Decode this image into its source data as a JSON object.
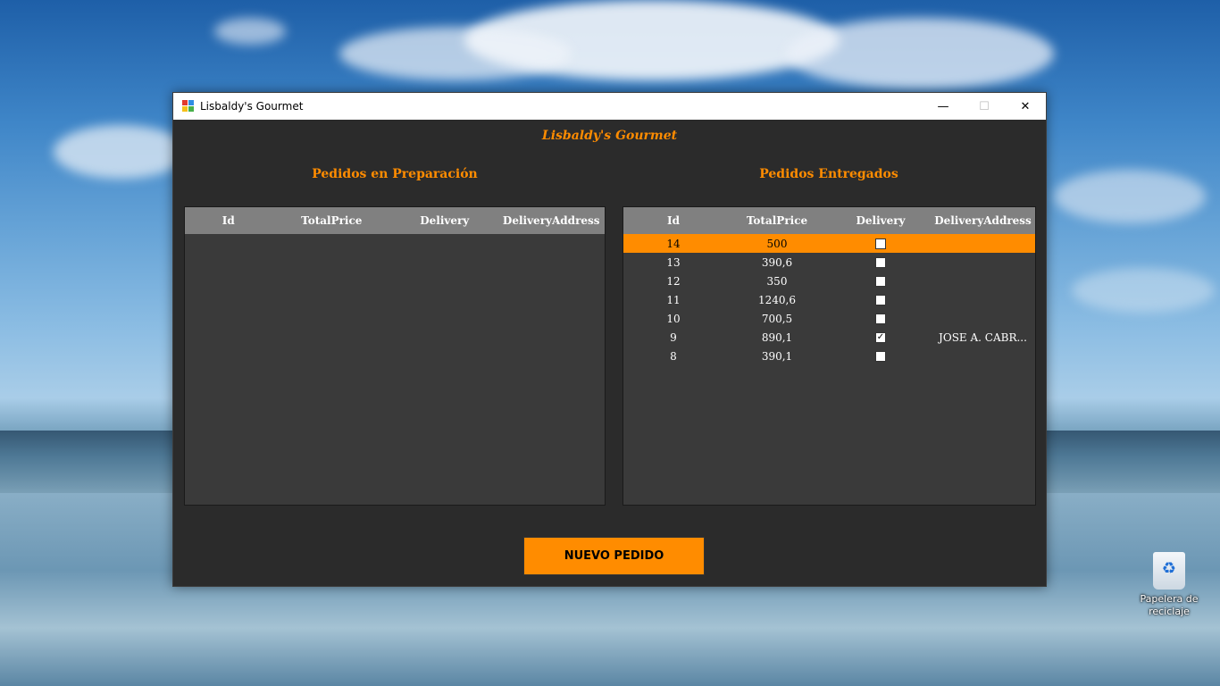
{
  "window": {
    "title": "Lisbaldy's Gourmet",
    "controls": {
      "minimize": "—",
      "maximize": "☐",
      "close": "✕"
    }
  },
  "app": {
    "title": "Lisbaldy's Gourmet",
    "accent_color": "#ff8c00"
  },
  "preparing": {
    "title": "Pedidos en Preparación",
    "columns": [
      "Id",
      "TotalPrice",
      "Delivery",
      "DeliveryAddress"
    ],
    "rows": []
  },
  "delivered": {
    "title": "Pedidos Entregados",
    "columns": [
      "Id",
      "TotalPrice",
      "Delivery",
      "DeliveryAddress"
    ],
    "rows": [
      {
        "id": "14",
        "total": "500",
        "delivery": false,
        "address": "",
        "selected": true
      },
      {
        "id": "13",
        "total": "390,6",
        "delivery": false,
        "address": ""
      },
      {
        "id": "12",
        "total": "350",
        "delivery": false,
        "address": ""
      },
      {
        "id": "11",
        "total": "1240,6",
        "delivery": false,
        "address": ""
      },
      {
        "id": "10",
        "total": "700,5",
        "delivery": false,
        "address": ""
      },
      {
        "id": "9",
        "total": "890,1",
        "delivery": true,
        "address": "JOSE A. CABR..."
      },
      {
        "id": "8",
        "total": "390,1",
        "delivery": false,
        "address": ""
      }
    ]
  },
  "actions": {
    "new_order": "NUEVO PEDIDO"
  },
  "desktop": {
    "icon": "recycle-bin-icon",
    "label_line1": "Papelera de",
    "label_line2": "reciclaje"
  }
}
